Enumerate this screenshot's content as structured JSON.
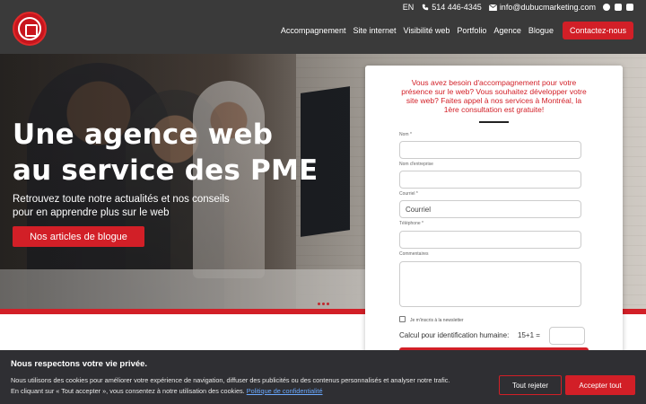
{
  "header": {
    "language": "EN",
    "phone": "514 446-4345",
    "email": "info@dubucmarketing.com",
    "nav": [
      "Accompagnement",
      "Site internet",
      "Visibilité web",
      "Portfolio",
      "Agence",
      "Blogue"
    ],
    "contact_label": "Contactez-nous",
    "icons": [
      "phone-icon",
      "envelope-icon",
      "facebook-icon",
      "instagram-icon",
      "linkedin-icon"
    ]
  },
  "hero": {
    "title_line1": "Une agence web",
    "title_line2": "au service des PME",
    "subtitle": "Retrouvez toute notre actualités et nos conseils pour en apprendre plus sur le web",
    "button_label": "Nos articles de blogue"
  },
  "form": {
    "intro": "Vous avez besoin d'accompagnement pour votre présence sur le web? Vous souhaitez développer votre site web? Faites appel à nos services à Montréal, la 1ère consultation est gratuite!",
    "name_label": "Nom *",
    "company_label": "Nom d'entreprise",
    "email_label": "Courriel *",
    "email_placeholder": "Courriel",
    "phone_label": "Téléphone *",
    "comments_label": "Commentaires",
    "newsletter_label": "Je m'inscris à la newsletter",
    "captcha_label": "Calcul pour identification humaine:",
    "captcha_question": "15+1 ="
  },
  "cookie": {
    "title": "Nous respectons votre vie privée.",
    "text_line1": "Nous utilisons des cookies pour améliorer votre expérience de navigation, diffuser des publicités ou des contenus personnalisés et analyser notre trafic.",
    "text_line2": "En cliquant sur « Tout accepter », vous consentez à notre utilisation des cookies.",
    "policy_link": "Politique de confidentialité",
    "reject_label": "Tout rejeter",
    "accept_label": "Accepter tout"
  },
  "colors": {
    "brand_red": "#d21f27",
    "header_bg": "#3a3a3a",
    "banner_bg": "#2f2f33"
  }
}
